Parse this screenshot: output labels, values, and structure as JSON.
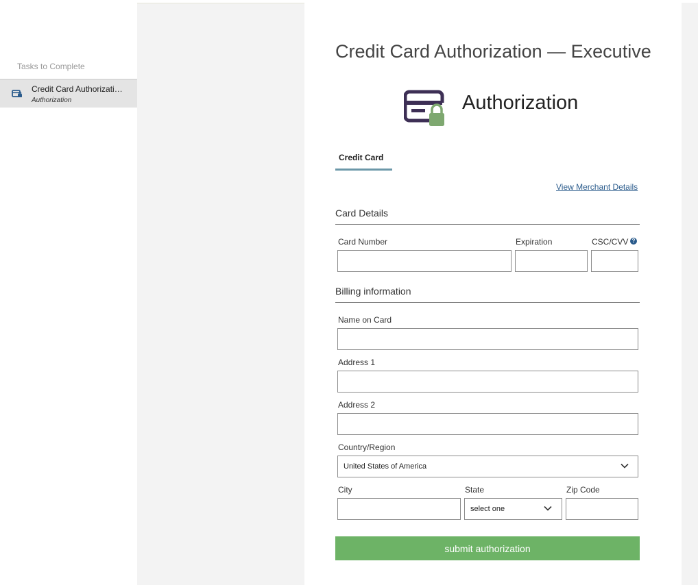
{
  "sidebar": {
    "heading": "Tasks to Complete",
    "tasks": [
      {
        "title": "Credit Card Authorizati…",
        "subtitle": "Authorization",
        "icon": "card-lock-icon",
        "selected": true
      }
    ]
  },
  "main": {
    "title": "Credit Card Authorization — Executive",
    "hero_label": "Authorization",
    "hero_icon": "credit-card-lock-icon",
    "tabs": [
      {
        "label": "Credit Card",
        "active": true
      }
    ],
    "merchant_link": "View Merchant Details",
    "card_details": {
      "heading": "Card Details",
      "card_number_label": "Card Number",
      "card_number_value": "",
      "expiration_label": "Expiration",
      "expiration_value": "",
      "csc_label": "CSC/CVV",
      "csc_value": "",
      "help_icon": "question-circle-icon"
    },
    "billing": {
      "heading": "Billing information",
      "name_label": "Name on Card",
      "name_value": "",
      "address1_label": "Address 1",
      "address1_value": "",
      "address2_label": "Address 2",
      "address2_value": "",
      "country_label": "Country/Region",
      "country_value": "United States of America",
      "city_label": "City",
      "city_value": "",
      "state_label": "State",
      "state_value": "select one",
      "zip_label": "Zip Code",
      "zip_value": ""
    },
    "submit_label": "submit authorization"
  },
  "colors": {
    "submit": "#6db366",
    "tab_underline": "#6b97a8",
    "link": "#2a5b8c",
    "icon_purple": "#3d2f55",
    "icon_lock": "#7ea870"
  }
}
